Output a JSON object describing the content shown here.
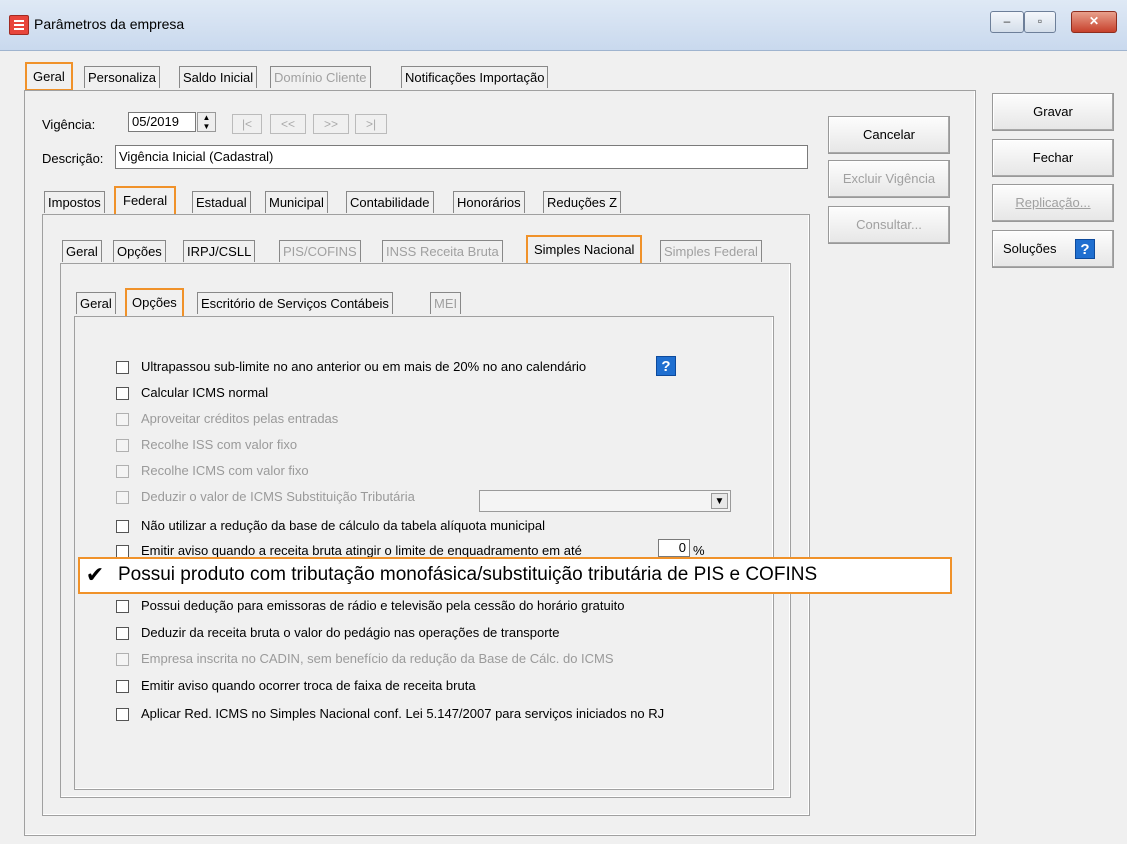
{
  "window": {
    "title": "Parâmetros da empresa",
    "minimize": "‒",
    "maximize": "▫",
    "close": "✕"
  },
  "top_tabs": [
    {
      "label": "Geral"
    },
    {
      "label": "Personaliza"
    },
    {
      "label": "Saldo Inicial"
    },
    {
      "label": "Domínio Cliente"
    },
    {
      "label": "Notificações Importação"
    }
  ],
  "vigencia": {
    "label": "Vigência:",
    "value": "05/2019",
    "nav": [
      "|<",
      "<<",
      ">>",
      ">|"
    ]
  },
  "descricao": {
    "label": "Descrição:",
    "value": "Vigência Inicial (Cadastral)"
  },
  "tax_tabs": [
    {
      "label": "Impostos"
    },
    {
      "label": "Federal"
    },
    {
      "label": "Estadual"
    },
    {
      "label": "Municipal"
    },
    {
      "label": "Contabilidade"
    },
    {
      "label": "Honorários"
    },
    {
      "label": "Reduções Z"
    }
  ],
  "federal_tabs": [
    {
      "label": "Geral"
    },
    {
      "label": "Opções"
    },
    {
      "label": "IRPJ/CSLL"
    },
    {
      "label": "PIS/COFINS"
    },
    {
      "label": "INSS Receita Bruta"
    },
    {
      "label": "Simples Nacional"
    },
    {
      "label": "Simples Federal"
    }
  ],
  "simples_tabs": [
    {
      "label": "Geral"
    },
    {
      "label": "Opções"
    },
    {
      "label": "Escritório de Serviços Contábeis"
    },
    {
      "label": "MEI"
    }
  ],
  "options": [
    {
      "label": "Ultrapassou sub-limite no ano anterior ou em mais de 20% no ano calendário",
      "checked": false,
      "enabled": true
    },
    {
      "label": "Calcular ICMS normal",
      "checked": false,
      "enabled": true
    },
    {
      "label": "Aproveitar créditos pelas entradas",
      "checked": false,
      "enabled": false
    },
    {
      "label": "Recolhe ISS com valor fixo",
      "checked": false,
      "enabled": false
    },
    {
      "label": "Recolhe ICMS com valor fixo",
      "checked": false,
      "enabled": false
    },
    {
      "label": "Deduzir o valor de ICMS Substituição Tributária",
      "checked": false,
      "enabled": false
    },
    {
      "label": "Não utilizar a redução da base de cálculo da tabela alíquota municipal",
      "checked": false,
      "enabled": true
    },
    {
      "label": "Emitir aviso quando a receita bruta atingir o limite de enquadramento em até",
      "checked": false,
      "enabled": true
    },
    {
      "label": "Possui produto com tributação monofásica/substituição tributária de PIS e COFINS",
      "checked": true,
      "enabled": true
    },
    {
      "label": "Possui dedução para emissoras de rádio e televisão pela cessão do horário gratuito",
      "checked": false,
      "enabled": true
    },
    {
      "label": "Deduzir da receita bruta o valor do pedágio nas operações de transporte",
      "checked": false,
      "enabled": true
    },
    {
      "label": "Empresa inscrita no CADIN, sem benefício da redução da Base de Cálc. do ICMS",
      "checked": false,
      "enabled": false
    },
    {
      "label": "Emitir aviso quando ocorrer troca de faixa de receita bruta",
      "checked": false,
      "enabled": true
    },
    {
      "label": "Aplicar Red. ICMS no Simples Nacional conf. Lei 5.147/2007 para serviços iniciados no RJ",
      "checked": false,
      "enabled": true
    }
  ],
  "limite_percent": {
    "value": "0",
    "unit": "%"
  },
  "middle_buttons": [
    {
      "label": "Cancelar",
      "enabled": true
    },
    {
      "label": "Excluir Vigência",
      "enabled": false
    },
    {
      "label": "Consultar...",
      "enabled": false
    }
  ],
  "right_buttons": [
    {
      "label": "Gravar",
      "enabled": true
    },
    {
      "label": "Fechar",
      "enabled": true
    },
    {
      "label": "Replicação...",
      "enabled": false
    },
    {
      "label": "Soluções",
      "enabled": true
    }
  ],
  "help_glyph": "?",
  "checkmark_glyph": "✔",
  "colors": {
    "highlight": "#f0922a",
    "help_blue": "#1f6fd0",
    "disabled_text": "#a0a0a0"
  }
}
